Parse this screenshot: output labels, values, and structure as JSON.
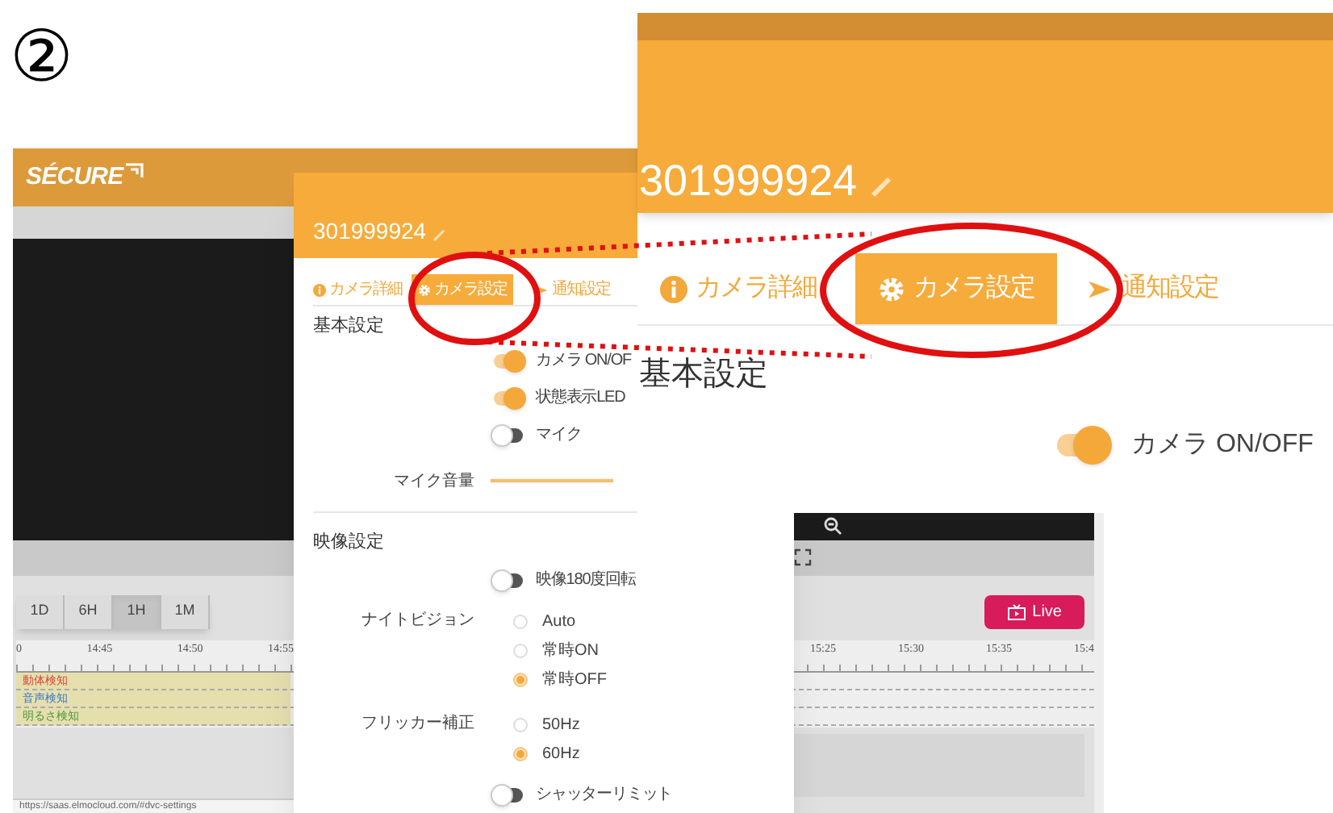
{
  "step_marker": "②",
  "app": {
    "logo": "SÉCURE",
    "range_buttons": [
      {
        "label": "1D",
        "selected": false
      },
      {
        "label": "6H",
        "selected": false
      },
      {
        "label": "1H",
        "selected": true
      },
      {
        "label": "1M",
        "selected": false
      }
    ],
    "timeline": {
      "left_ticks": [
        "0",
        "14:45",
        "14:50",
        "14:55"
      ],
      "right_ticks": [
        "15:25",
        "15:30",
        "15:35",
        "15:4"
      ],
      "rows": [
        {
          "label": "動体検知",
          "color": "#d9443a"
        },
        {
          "label": "音声検知",
          "color": "#3b78c9"
        },
        {
          "label": "明るさ検知",
          "color": "#4f9a3a"
        }
      ]
    },
    "live_button": "Live",
    "status_url": "https://saas.elmocloud.com/#dvc-settings"
  },
  "settings_panel": {
    "device_name": "301999924",
    "tabs": [
      {
        "label": "カメラ詳細",
        "selected": false
      },
      {
        "label": "カメラ設定",
        "selected": true
      },
      {
        "label": "通知設定",
        "selected": false
      }
    ],
    "sections": [
      {
        "title": "基本設定",
        "items": [
          {
            "kind": "toggle",
            "label": "カメラ ON/OF",
            "on": true
          },
          {
            "kind": "toggle",
            "label": "状態表示LED",
            "on": true
          },
          {
            "kind": "toggle",
            "label": "マイク",
            "on": false
          },
          {
            "kind": "slider",
            "label": "マイク音量",
            "level": 1
          }
        ]
      },
      {
        "title": "映像設定",
        "items": [
          {
            "kind": "toggle",
            "label": "映像180度回転",
            "on": false
          },
          {
            "kind": "radio",
            "label": "ナイトビジョン",
            "options": [
              {
                "label": "Auto",
                "selected": false
              },
              {
                "label": "常時ON",
                "selected": false
              },
              {
                "label": "常時OFF",
                "selected": true
              }
            ]
          },
          {
            "kind": "radio",
            "label": "フリッカー補正",
            "options": [
              {
                "label": "50Hz",
                "selected": false
              },
              {
                "label": "60Hz",
                "selected": true
              }
            ]
          },
          {
            "kind": "toggle",
            "label": "シャッターリミット",
            "on": false
          }
        ]
      }
    ]
  },
  "zoom_panel": {
    "device_name": "301999924",
    "tabs": [
      {
        "label": "カメラ詳細",
        "selected": false
      },
      {
        "label": "カメラ設定",
        "selected": true
      },
      {
        "label": "通知設定",
        "selected": false
      }
    ],
    "section_title": "基本設定",
    "toggle": {
      "label": "カメラ ON/OFF",
      "on": true
    }
  }
}
